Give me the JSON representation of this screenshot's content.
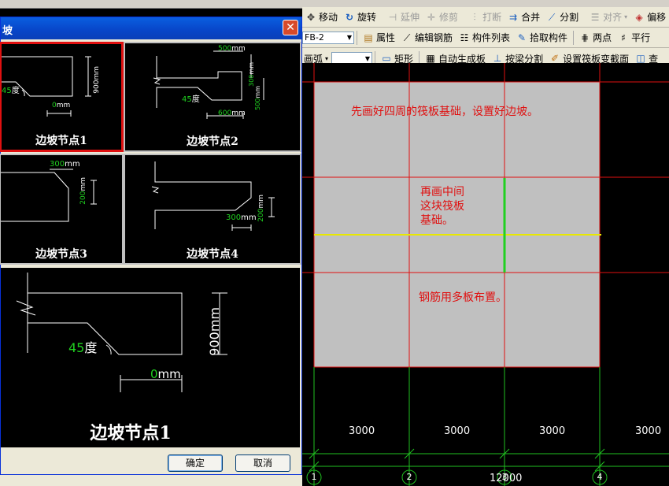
{
  "toolbar1": {
    "items": [
      {
        "icon": "move-icon",
        "label": "移动",
        "disabled": false
      },
      {
        "icon": "rotate-icon",
        "label": "旋转",
        "disabled": false
      },
      {
        "icon": "extend-icon",
        "label": "延伸",
        "disabled": true
      },
      {
        "icon": "trim-icon",
        "label": "修剪",
        "disabled": true
      },
      {
        "icon": "break-icon",
        "label": "打断",
        "disabled": true
      },
      {
        "icon": "merge-icon",
        "label": "合并",
        "disabled": false
      },
      {
        "icon": "split-icon",
        "label": "分割",
        "disabled": false
      },
      {
        "icon": "align-icon",
        "label": "对齐",
        "disabled": true
      },
      {
        "icon": "offset-icon",
        "label": "偏移",
        "disabled": false
      }
    ]
  },
  "toolbar2": {
    "combo_value": "FB-2",
    "items": [
      {
        "icon": "properties-icon",
        "label": "属性"
      },
      {
        "icon": "edit-rebar-icon",
        "label": "编辑钢筋"
      },
      {
        "icon": "component-list-icon",
        "label": "构件列表"
      },
      {
        "icon": "pick-component-icon",
        "label": "拾取构件"
      },
      {
        "icon": "two-point-icon",
        "label": "两点"
      },
      {
        "icon": "parallel-icon",
        "label": "平行"
      }
    ]
  },
  "toolbar3": {
    "arc_label": "画弧",
    "items": [
      {
        "icon": "rectangle-icon",
        "label": "矩形"
      },
      {
        "icon": "auto-generate-icon",
        "label": "自动生成板"
      },
      {
        "icon": "split-by-beam-icon",
        "label": "按梁分割"
      },
      {
        "icon": "set-section-icon",
        "label": "设置筏板变截面"
      },
      {
        "icon": "check-icon",
        "label": "查"
      }
    ]
  },
  "dialog": {
    "title": "坡",
    "tiles": [
      {
        "caption": "边坡节点1",
        "selected": true
      },
      {
        "caption": "边坡节点2",
        "selected": false
      },
      {
        "caption": "边坡节点3",
        "selected": false
      },
      {
        "caption": "边坡节点4",
        "selected": false
      }
    ],
    "node1": {
      "height": "900",
      "height_unit": "mm",
      "angle": "45",
      "angle_unit": "度",
      "offset": "0",
      "offset_unit": "mm"
    },
    "node2": {
      "top": "500",
      "top_unit": "mm",
      "h1": "300",
      "h1_unit": "mm",
      "h2": "500",
      "h2_unit": "mm",
      "bottom": "600",
      "bottom_unit": "mm",
      "angle": "45",
      "angle_unit": "度"
    },
    "node3": {
      "width": "300",
      "width_unit": "mm",
      "height": "200",
      "height_unit": "mm"
    },
    "node4": {
      "width": "300",
      "width_unit": "mm",
      "height": "200",
      "height_unit": "mm"
    },
    "preview": {
      "caption": "边坡节点1",
      "height": "900",
      "height_unit": "mm",
      "angle": "45",
      "angle_unit": "度",
      "offset": "0",
      "offset_unit": "mm"
    },
    "ok_label": "确定",
    "cancel_label": "取消"
  },
  "canvas": {
    "notes": {
      "top": "先画好四周的筏板基础，设置好边坡。",
      "middle": "再画中间\n这块筏板\n基础。",
      "bottom": "钢筋用多板布置。"
    },
    "dimensions": [
      "3000",
      "3000",
      "3000",
      "3000"
    ],
    "total_dimension": "12000",
    "axes": [
      "1",
      "2",
      "3",
      "4"
    ],
    "colors": {
      "slab": "#c0c0c0",
      "grid": "#e01010",
      "yellow_line": "#e8e800",
      "green_line": "#20d020"
    }
  }
}
